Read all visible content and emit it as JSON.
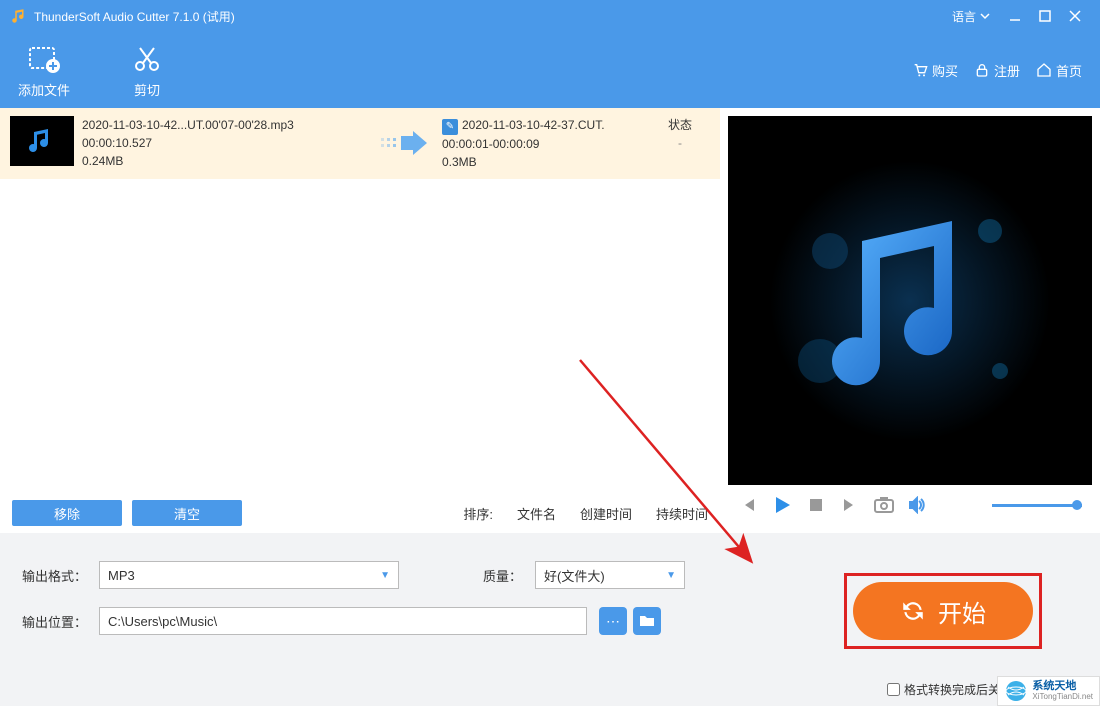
{
  "titlebar": {
    "title": "ThunderSoft Audio Cutter 7.1.0 (试用)",
    "language_label": "语言"
  },
  "toolbar": {
    "add_file": "添加文件",
    "cut": "剪切",
    "buy": "购买",
    "register": "注册",
    "home": "首页"
  },
  "file": {
    "src_name": "2020-11-03-10-42...UT.00'07-00'28.mp3",
    "src_duration": "00:00:10.527",
    "src_size": "0.24MB",
    "dst_name": "2020-11-03-10-42-37.CUT.",
    "dst_range": "00:00:01-00:00:09",
    "dst_size": "0.3MB",
    "status_label": "状态",
    "status_value": "-"
  },
  "list_actions": {
    "remove": "移除",
    "clear": "清空",
    "sort_label": "排序:",
    "sort_filename": "文件名",
    "sort_created": "创建时间",
    "sort_duration": "持续时间"
  },
  "output": {
    "format_label": "输出格式：",
    "format_value": "MP3",
    "quality_label": "质量：",
    "quality_value": "好(文件大)",
    "location_label": "输出位置：",
    "location_value": "C:\\Users\\pc\\Music\\",
    "start": "开始",
    "shutdown_label": "格式转换完成后关"
  },
  "watermark": {
    "title": "系统天地",
    "sub": "XiTongTianDi.net"
  }
}
